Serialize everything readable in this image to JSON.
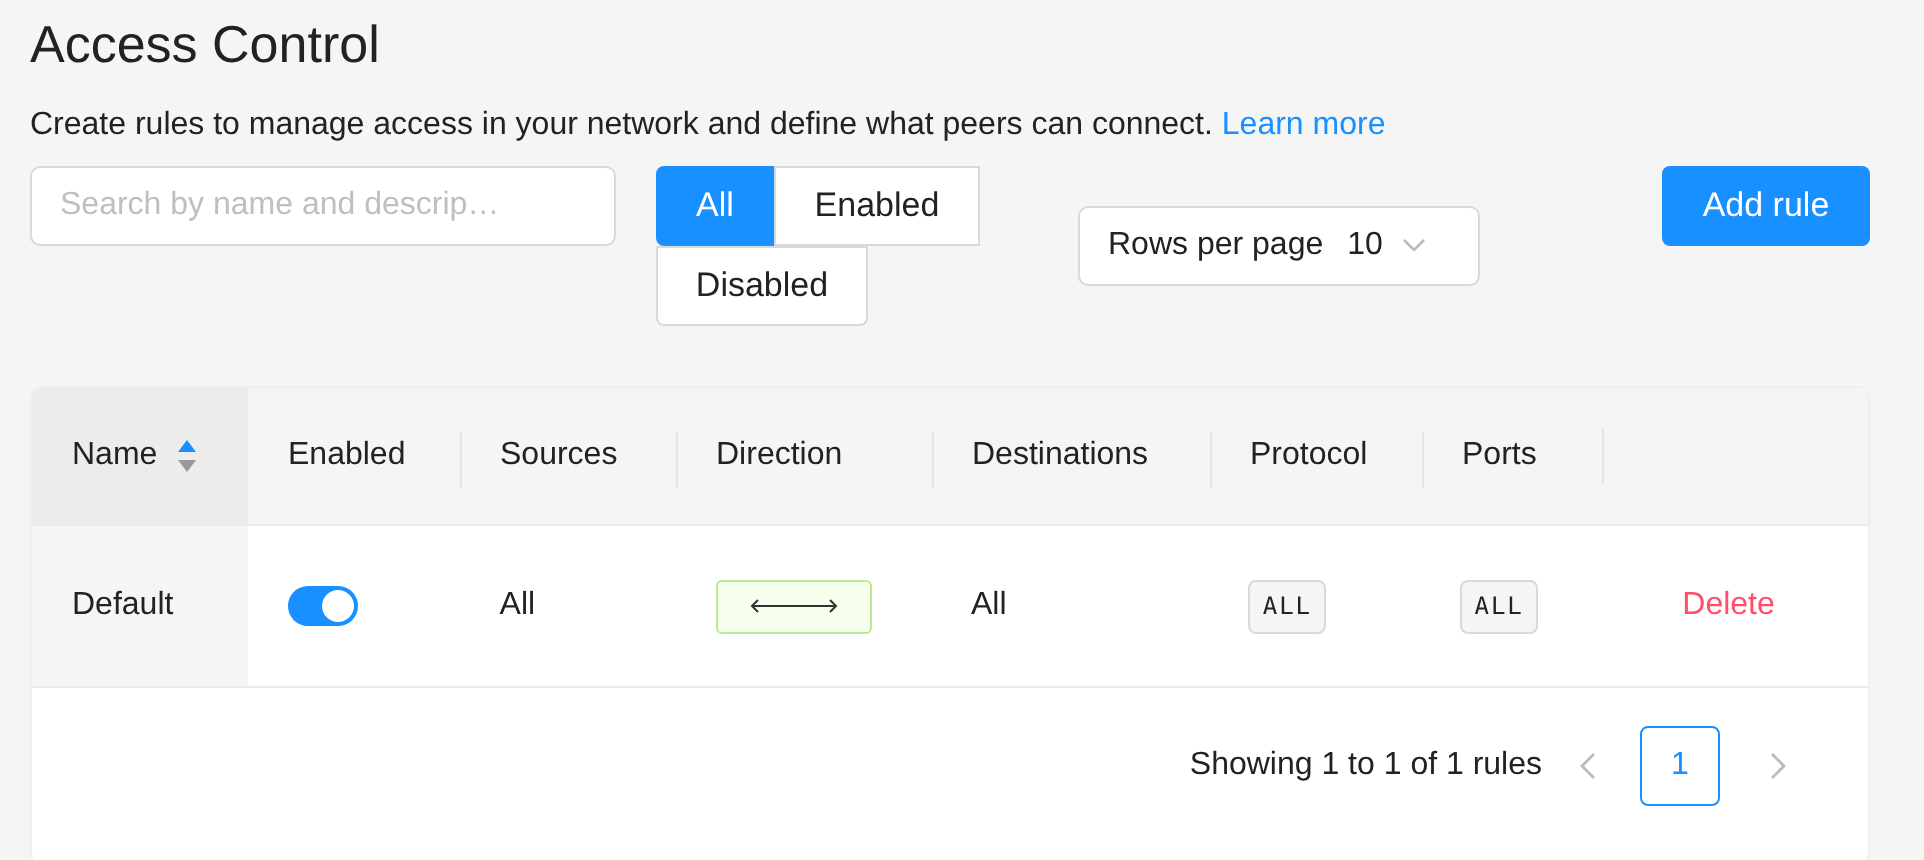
{
  "page": {
    "title": "Access Control",
    "description": "Create rules to manage access in your network and define what peers can connect.",
    "link": "Learn more"
  },
  "search": {
    "placeholder": "Search by name and descrip…"
  },
  "filters": [
    {
      "label": "All",
      "selected": true
    },
    {
      "label": "Enabled",
      "selected": false
    },
    {
      "label": "Disabled",
      "selected": false
    }
  ],
  "rows_per_page": {
    "label": "Rows per page",
    "value": "10"
  },
  "add_button": "Add rule",
  "table": {
    "columns": [
      {
        "label": "Name",
        "sorted": true
      },
      {
        "label": "Enabled",
        "sorted": false
      },
      {
        "label": "Sources",
        "sorted": false
      },
      {
        "label": "Direction",
        "sorted": false
      },
      {
        "label": "Destinations",
        "sorted": false
      },
      {
        "label": "Protocol",
        "sorted": false
      },
      {
        "label": "Ports",
        "sorted": false
      }
    ],
    "rows": [
      {
        "name": "Default",
        "enabled": true,
        "sources": "All",
        "destinations": "All",
        "protocol": "ALL",
        "ports": "ALL",
        "action": "Delete"
      }
    ]
  },
  "pagination": {
    "summary": "Showing 1 to 1 of 1 rules",
    "pages": [
      {
        "label": "1",
        "selected": true
      }
    ]
  }
}
